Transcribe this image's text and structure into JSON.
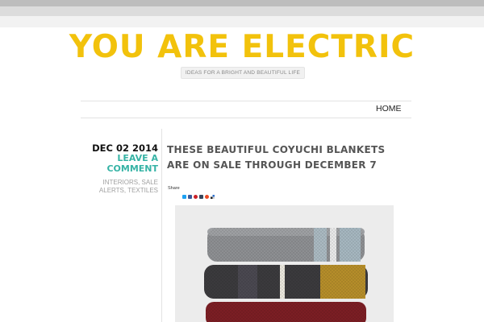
{
  "site": {
    "title": "YOU ARE ELECTRIC",
    "tagline": "IDEAS FOR A BRIGHT AND BEAUTIFUL LIFE"
  },
  "nav": {
    "items": [
      {
        "label": "HOME"
      }
    ]
  },
  "post": {
    "date": "DEC 02 2014",
    "comment_link": "LEAVE A COMMENT",
    "categories": [
      "INTERIORS",
      "SALE ALERTS",
      "TEXTILES"
    ],
    "title": "THESE BEAUTIFUL COYUCHI BLANKETS ARE ON SALE THROUGH DECEMBER 7",
    "share": {
      "label": "Share",
      "icons": [
        {
          "name": "twitter-icon",
          "color": "#1da1f2"
        },
        {
          "name": "facebook-icon",
          "color": "#3b5998"
        },
        {
          "name": "pinterest-icon",
          "color": "#cb2027"
        },
        {
          "name": "tumblr-icon",
          "color": "#35465c"
        },
        {
          "name": "stumbleupon-icon",
          "color": "#eb4924"
        },
        {
          "name": "delicious-icon",
          "color": "#3274d1"
        }
      ]
    }
  },
  "colors": {
    "title": "#f2c20c",
    "link_accent": "#36b3a5"
  }
}
